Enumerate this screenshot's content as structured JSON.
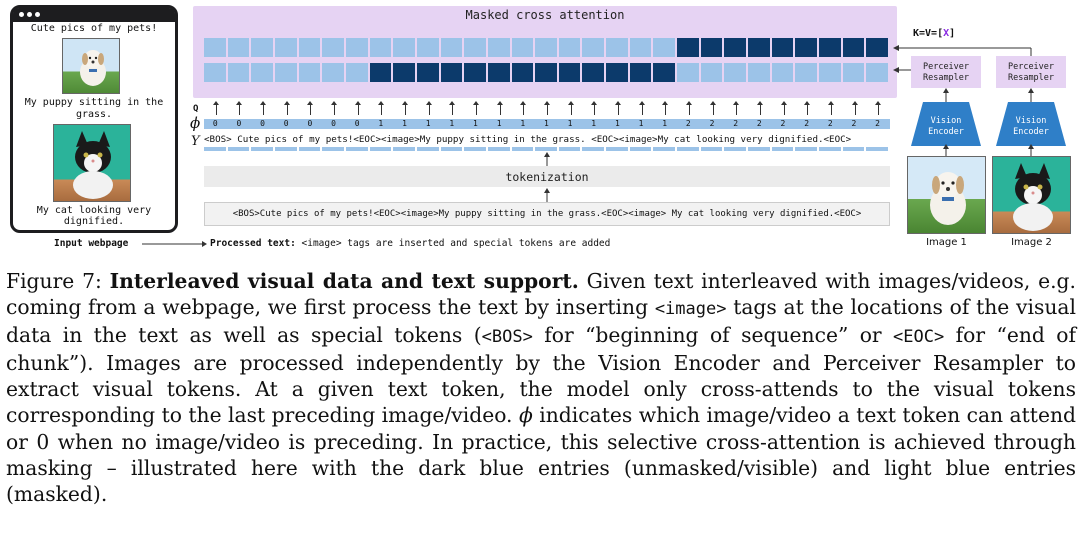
{
  "figure": {
    "webpage": {
      "line1": "Cute pics of my pets!",
      "line2a": "My puppy sitting in the",
      "line2b": "grass.",
      "line3a": "My cat looking very",
      "line3b": "dignified."
    },
    "labels": {
      "input_webpage": "Input webpage",
      "processed_text_bold": "Processed text:",
      "processed_text_rest": " <image> tags are inserted and special tokens are added",
      "masked_cross_attention": "Masked cross attention",
      "kv": "K=V=[",
      "kv_x": "X",
      "kv_end": "]",
      "q": "Q",
      "phi": "ϕ",
      "y": "Y",
      "tokenization": "tokenization",
      "perceiver_1": "Perceiver",
      "resampler_1": "Resampler",
      "perceiver_2": "Perceiver",
      "resampler_2": "Resampler",
      "vision_1": "Vision",
      "encoder_1": "Encoder",
      "vision_2": "Vision",
      "encoder_2": "Encoder",
      "image1": "Image 1",
      "image2": "Image 2"
    },
    "tokens_line": "<BOS> Cute pics of my pets!<EOC><image>My puppy sitting in the grass. <EOC><image>My cat looking very dignified.<EOC>",
    "raw_line": "<BOS>Cute pics of my pets!<EOC><image>My puppy sitting in the grass.<EOC><image> My cat looking very dignified.<EOC>",
    "phi_values": [
      "0",
      "0",
      "0",
      "0",
      "0",
      "0",
      "0",
      "1",
      "1",
      "1",
      "1",
      "1",
      "1",
      "1",
      "1",
      "1",
      "1",
      "1",
      "1",
      "1",
      "2",
      "2",
      "2",
      "2",
      "2",
      "2",
      "2",
      "2",
      "2"
    ],
    "colors": {
      "light_blue": "#9cc3e8",
      "dark_blue": "#0c3a6b",
      "lavender": "#e6d3f3",
      "encoder_blue": "#2f7fc8"
    }
  },
  "caption": {
    "prefix": "Figure 7:  ",
    "title": "Interleaved visual data and text support.",
    "p1": " Given text interleaved with images/videos, e.g. coming from a webpage, we first process the text by inserting ",
    "tag_image": "<image>",
    "p2": " tags at the locations of the visual data in the text as well as special tokens (",
    "tag_bos": "<BOS>",
    "p3": " for “beginning of sequence” or ",
    "tag_eoc": "<EOC>",
    "p4": " for “end of chunk”). Images are processed independently by the Vision Encoder and Perceiver Resampler to extract visual tokens. At a given text token, the model only cross-attends to the visual tokens corresponding to the last preceding image/video. ",
    "phi": "ϕ",
    "p5": " indicates which image/video a text token can attend or 0 when no image/video is preceding. In practice, this selective cross-attention is achieved through masking – illustrated here with the dark blue entries (unmasked/visible) and light blue entries (masked)."
  }
}
